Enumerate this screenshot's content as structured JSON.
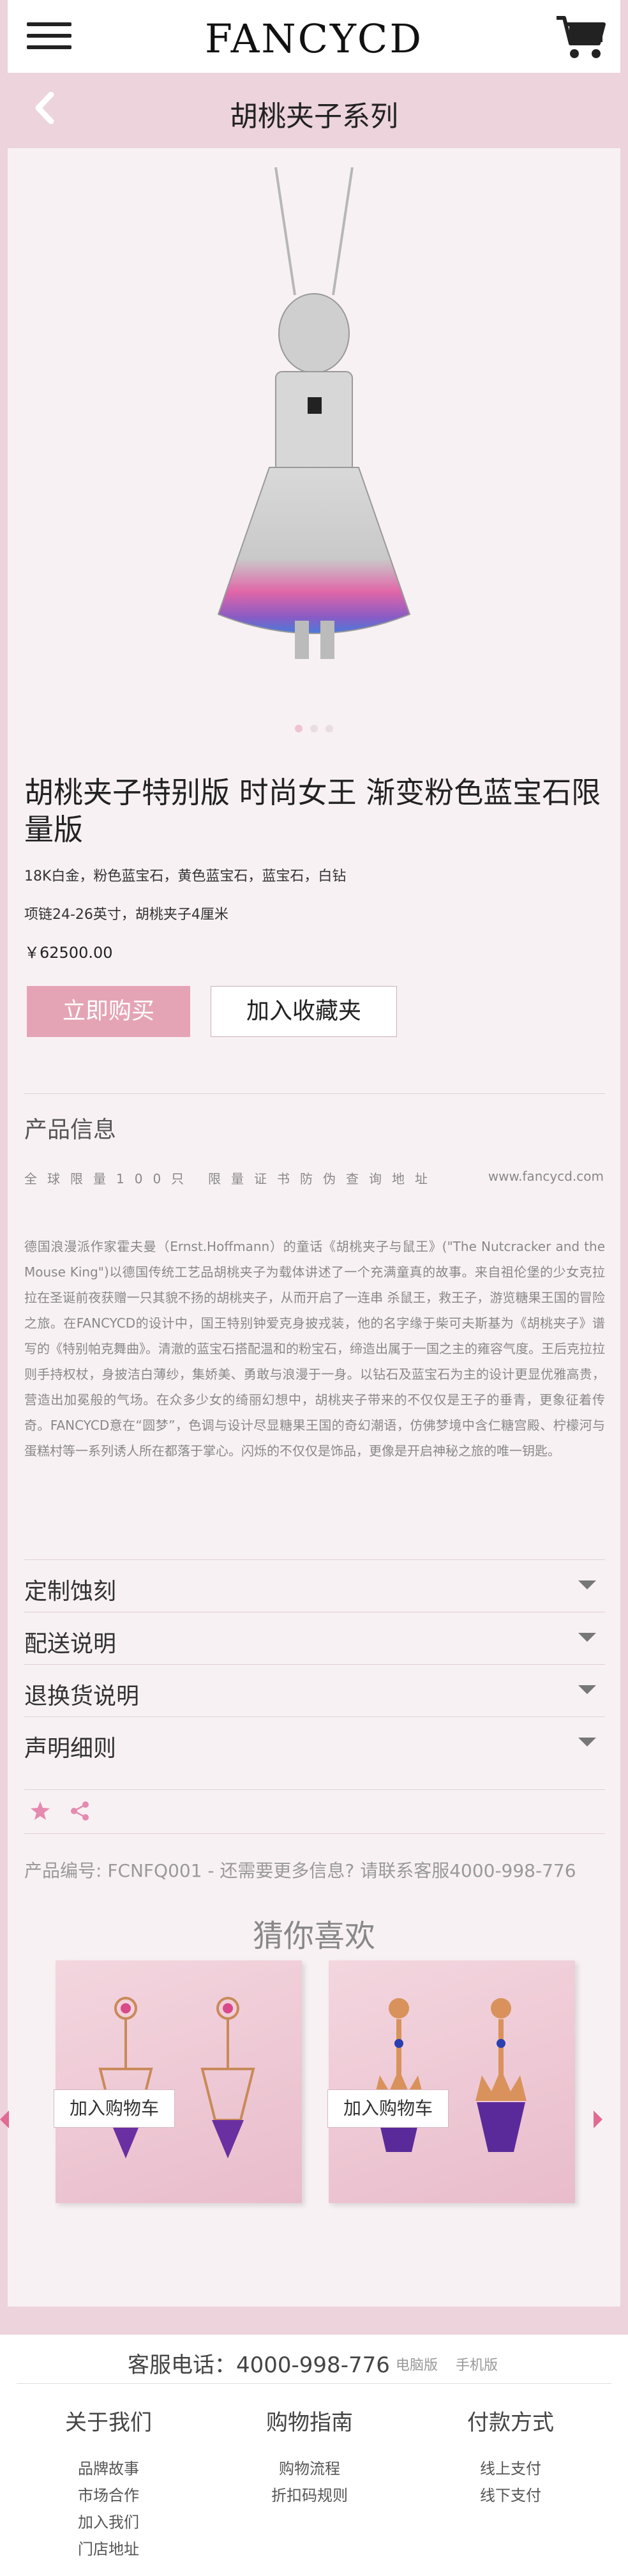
{
  "header": {
    "logo": "FANCYCD",
    "page_title": "胡桃夹子系列"
  },
  "product": {
    "title": "胡桃夹子特别版 时尚女王 渐变粉色蓝宝石限量版",
    "spec1": "18K白金，粉色蓝宝石，黄色蓝宝石，蓝宝石，白钻",
    "spec2": "项链24-26英寸，胡桃夹子4厘米",
    "price": "￥62500.00",
    "buy_label": "立即购买",
    "fav_label": "加入收藏夹",
    "carousel_dots": 3,
    "carousel_active": 0
  },
  "info": {
    "heading": "产品信息",
    "limit_left": "全球限量100只",
    "limit_mid": "限量证书防伪查询地址",
    "limit_url": "www.fancycd.com",
    "description": "德国浪漫派作家霍夫曼（Ernst.Hoffmann）的童话《胡桃夹子与鼠王》(\"The Nutcracker and the Mouse King\")以德国传统工艺品胡桃夹子为载体讲述了一个充满童真的故事。来自祖伦堡的少女克拉拉在圣诞前夜获赠一只其貌不扬的胡桃夹子，从而开启了一连串 杀鼠王，救王子，游览糖果王国的冒险之旅。在FANCYCD的设计中，国王特别钟爱克身披戎装，他的名字缘于柴可夫斯基为《胡桃夹子》谱写的《特别帕克舞曲》。清澈的蓝宝石搭配温和的粉宝石，缔造出属于一国之主的雍容气度。王后克拉拉则手持权杖，身披洁白薄纱，集娇美、勇敢与浪漫于一身。以钻石及蓝宝石为主的设计更显优雅高贵，营造出加冕般的气场。在众多少女的绮丽幻想中，胡桃夹子带来的不仅仅是王子的垂青，更象征着传奇。FANCYCD意在“圆梦”，色调与设计尽显糖果王国的奇幻潮语，仿佛梦境中含仁糖宫殿、柠檬河与蛋糕村等一系列诱人所在都落于掌心。闪烁的不仅仅是饰品，更像是开启神秘之旅的唯一钥匙。"
  },
  "accordion": [
    {
      "label": "定制蚀刻"
    },
    {
      "label": "配送说明"
    },
    {
      "label": "退换货说明"
    },
    {
      "label": "声明细则"
    }
  ],
  "product_code_line": "产品编号: FCNFQ001 - 还需要更多信息? 请联系客服4000-998-776",
  "recommend": {
    "title": "猜你喜欢",
    "items": [
      {
        "button": "加入购物车"
      },
      {
        "button": "加入购物车"
      }
    ]
  },
  "footer": {
    "hotline": "客服电话：4000-998-776",
    "link_pc": "电脑版",
    "link_mobile": "手机版",
    "columns": [
      {
        "title": "关于我们",
        "items": [
          "品牌故事",
          "市场合作",
          "加入我们",
          "门店地址"
        ]
      },
      {
        "title": "购物指南",
        "items": [
          "购物流程",
          "折扣码规则"
        ]
      },
      {
        "title": "付款方式",
        "items": [
          "线上支付",
          "线下支付"
        ]
      }
    ]
  },
  "colors": {
    "brand_pink": "#e5a4b5",
    "background_pink": "#ecd3dc",
    "arrow_pink": "#e06b95"
  },
  "icons": [
    "menu-icon",
    "cart-icon",
    "back-icon",
    "star-icon",
    "share-icon",
    "chevron-down-icon"
  ]
}
